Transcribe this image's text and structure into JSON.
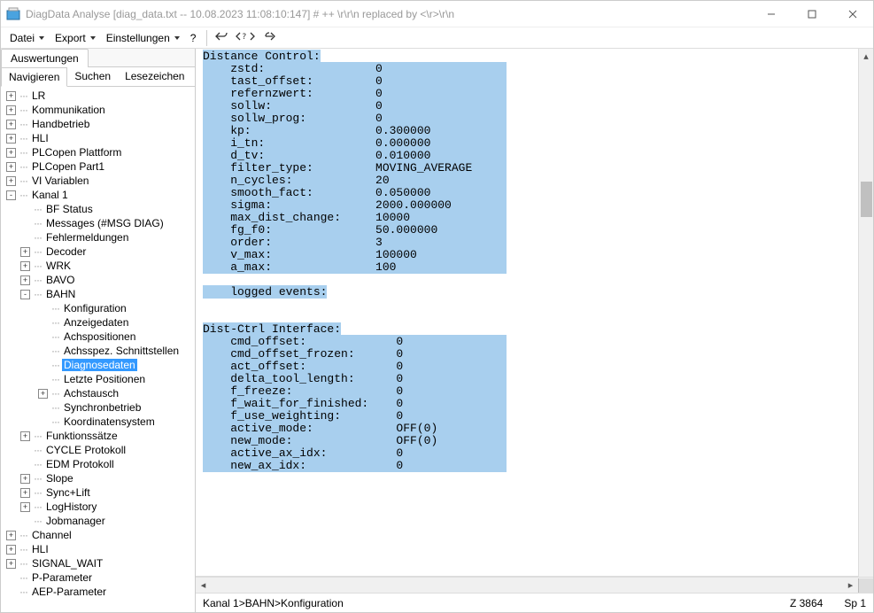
{
  "window": {
    "title": "DiagData Analyse [diag_data.txt -- 10.08.2023 11:08:10:147] # ++ \\r\\r\\n replaced by <\\r>\\r\\n"
  },
  "menu": {
    "file": "Datei",
    "export": "Export",
    "settings": "Einstellungen",
    "help": "?"
  },
  "left": {
    "top_tab": "Auswertungen",
    "sub_tabs": {
      "nav": "Navigieren",
      "search": "Suchen",
      "bookmarks": "Lesezeichen"
    }
  },
  "tree": [
    {
      "pm": "+",
      "lvl": 0,
      "label": "LR"
    },
    {
      "pm": "+",
      "lvl": 0,
      "label": "Kommunikation"
    },
    {
      "pm": "+",
      "lvl": 0,
      "label": "Handbetrieb"
    },
    {
      "pm": "+",
      "lvl": 0,
      "label": "HLI"
    },
    {
      "pm": "+",
      "lvl": 0,
      "label": "PLCopen Plattform"
    },
    {
      "pm": "+",
      "lvl": 0,
      "label": "PLCopen Part1"
    },
    {
      "pm": "+",
      "lvl": 0,
      "label": "VI Variablen"
    },
    {
      "pm": "-",
      "lvl": 0,
      "label": "Kanal 1"
    },
    {
      "pm": "",
      "lvl": 1,
      "label": "BF Status"
    },
    {
      "pm": "",
      "lvl": 1,
      "label": "Messages (#MSG DIAG)"
    },
    {
      "pm": "",
      "lvl": 1,
      "label": "Fehlermeldungen"
    },
    {
      "pm": "+",
      "lvl": 1,
      "label": "Decoder"
    },
    {
      "pm": "+",
      "lvl": 1,
      "label": "WRK"
    },
    {
      "pm": "+",
      "lvl": 1,
      "label": "BAVO"
    },
    {
      "pm": "-",
      "lvl": 1,
      "label": "BAHN"
    },
    {
      "pm": "",
      "lvl": 2,
      "label": "Konfiguration"
    },
    {
      "pm": "",
      "lvl": 2,
      "label": "Anzeigedaten"
    },
    {
      "pm": "",
      "lvl": 2,
      "label": "Achspositionen"
    },
    {
      "pm": "",
      "lvl": 2,
      "label": "Achsspez. Schnittstellen"
    },
    {
      "pm": "",
      "lvl": 2,
      "label": "Diagnosedaten",
      "selected": true
    },
    {
      "pm": "",
      "lvl": 2,
      "label": "Letzte Positionen"
    },
    {
      "pm": "+",
      "lvl": 2,
      "label": "Achstausch"
    },
    {
      "pm": "",
      "lvl": 2,
      "label": "Synchronbetrieb"
    },
    {
      "pm": "",
      "lvl": 2,
      "label": "Koordinatensystem"
    },
    {
      "pm": "+",
      "lvl": 1,
      "label": "Funktionssätze"
    },
    {
      "pm": "",
      "lvl": 1,
      "label": "CYCLE Protokoll"
    },
    {
      "pm": "",
      "lvl": 1,
      "label": "EDM Protokoll"
    },
    {
      "pm": "+",
      "lvl": 1,
      "label": "Slope"
    },
    {
      "pm": "+",
      "lvl": 1,
      "label": "Sync+Lift"
    },
    {
      "pm": "+",
      "lvl": 1,
      "label": "LogHistory"
    },
    {
      "pm": "",
      "lvl": 1,
      "label": "Jobmanager"
    },
    {
      "pm": "+",
      "lvl": 0,
      "label": "Channel"
    },
    {
      "pm": "+",
      "lvl": 0,
      "label": "HLI"
    },
    {
      "pm": "+",
      "lvl": 0,
      "label": "SIGNAL_WAIT"
    },
    {
      "pm": "",
      "lvl": 0,
      "label": "P-Parameter"
    },
    {
      "pm": "",
      "lvl": 0,
      "label": "AEP-Parameter"
    }
  ],
  "editor": {
    "lines": [
      {
        "key": "Distance Control:",
        "val": "",
        "pad": 0
      },
      {
        "key": "    zstd:",
        "val": "0",
        "pad": 25
      },
      {
        "key": "    tast_offset:",
        "val": "0",
        "pad": 25
      },
      {
        "key": "    refernzwert:",
        "val": "0",
        "pad": 25
      },
      {
        "key": "    sollw:",
        "val": "0",
        "pad": 25
      },
      {
        "key": "    sollw_prog:",
        "val": "0",
        "pad": 25
      },
      {
        "key": "    kp:",
        "val": "0.300000",
        "pad": 25
      },
      {
        "key": "    i_tn:",
        "val": "0.000000",
        "pad": 25
      },
      {
        "key": "    d_tv:",
        "val": "0.010000",
        "pad": 25
      },
      {
        "key": "    filter_type:",
        "val": "MOVING_AVERAGE",
        "pad": 25
      },
      {
        "key": "    n_cycles:",
        "val": "20",
        "pad": 25
      },
      {
        "key": "    smooth_fact:",
        "val": "0.050000",
        "pad": 25
      },
      {
        "key": "    sigma:",
        "val": "2000.000000",
        "pad": 25
      },
      {
        "key": "    max_dist_change:",
        "val": "10000",
        "pad": 25
      },
      {
        "key": "    fg_f0:",
        "val": "50.000000",
        "pad": 25
      },
      {
        "key": "    order:",
        "val": "3",
        "pad": 25
      },
      {
        "key": "    v_max:",
        "val": "100000",
        "pad": 25
      },
      {
        "key": "    a_max:",
        "val": "100",
        "pad": 25
      },
      {
        "blank": true
      },
      {
        "key": "    logged events:",
        "val": "",
        "pad": 0
      },
      {
        "blank": true
      },
      {
        "blank": true
      },
      {
        "key": "Dist-Ctrl Interface:",
        "val": "",
        "pad": 0
      },
      {
        "key": "    cmd_offset:",
        "val": "0",
        "pad": 28
      },
      {
        "key": "    cmd_offset_frozen:",
        "val": "0",
        "pad": 28
      },
      {
        "key": "    act_offset:",
        "val": "0",
        "pad": 28
      },
      {
        "key": "    delta_tool_length:",
        "val": "0",
        "pad": 28
      },
      {
        "key": "    f_freeze:",
        "val": "0",
        "pad": 28
      },
      {
        "key": "    f_wait_for_finished:",
        "val": "0",
        "pad": 28
      },
      {
        "key": "    f_use_weighting:",
        "val": "0",
        "pad": 28
      },
      {
        "key": "    active_mode:",
        "val": "OFF(0)",
        "pad": 28
      },
      {
        "key": "    new_mode:",
        "val": "OFF(0)",
        "pad": 28
      },
      {
        "key": "    active_ax_idx:",
        "val": "0",
        "pad": 28
      },
      {
        "key": "    new_ax_idx:",
        "val": "0",
        "pad": 28
      }
    ]
  },
  "status": {
    "path": "Kanal 1>BAHN>Konfiguration",
    "line": "Z 3864",
    "col": "Sp 1"
  }
}
